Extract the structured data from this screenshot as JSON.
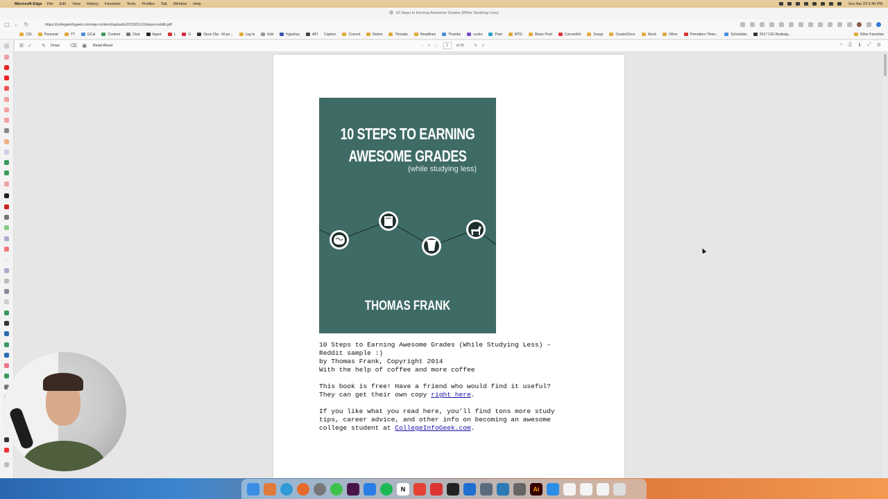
{
  "menubar": {
    "apple": "",
    "app_name": "Microsoft Edge",
    "menus": [
      "File",
      "Edit",
      "View",
      "History",
      "Favorites",
      "Tools",
      "Profiles",
      "Tab",
      "Window",
      "Help"
    ],
    "clock": "Sun Apr 23 5:46 PM"
  },
  "window": {
    "tab_title": "10 Steps to Earning Awesome Grades (While Studying Less)"
  },
  "address": {
    "back_icon": "back-arrow-icon",
    "refresh_icon": "refresh-icon",
    "url": "https://collegeinfogeek.com/wp-content/uploads/2015/01/10steps-reddit.pdf"
  },
  "favorites": {
    "items": [
      "CIG",
      "Personal",
      "YT",
      "GCal",
      "Content",
      "Chat",
      "Agent",
      "L",
      "G",
      "Opus Clip - AI-po...",
      "Log In",
      "Edit",
      "Hypefury",
      "API",
      "Caption",
      "Current",
      "Notion",
      "Threads",
      "Headlines",
      "Thumbs",
      "ccolor",
      "Poet",
      "MTG",
      "Music Prod",
      "ConvertKit",
      "Songs",
      "CreatorDocs",
      "Stock",
      "Other",
      "Pomodoro Timer...",
      "Schedules",
      "2017 CIG Redesig..."
    ],
    "other_favorites": "Other Favorites"
  },
  "pdf_toolbar": {
    "draw_label": "Draw",
    "read_aloud_label": "Read Aloud",
    "zoom_out": "−",
    "zoom_in": "+",
    "page_number": "1",
    "page_total": "of 29"
  },
  "pdf": {
    "cover": {
      "title_line1": "10 STEPS TO EARNING",
      "title_line2": "AWESOME GRADES",
      "subtitle": "(while studying less)",
      "author": "THOMAS FRANK",
      "background": "#3f6b66"
    },
    "text": {
      "line1": "10 Steps to Earning Awesome Grades (While Studying Less) –",
      "line2": "Reddit sample :)",
      "line3": "by Thomas Frank, Copyright 2014",
      "line4": "With the help of coffee and more coffee",
      "line5": "This book is free! Have a friend who would find it useful?",
      "line6_prefix": "They can get their own copy ",
      "line6_link": "right here",
      "line6_suffix": ".",
      "line7": "If you like what you read here, you’ll find tons more study",
      "line8": "tips, career advice, and other info on becoming an awesome",
      "line9_prefix": "college student at ",
      "line9_link": "CollegeInfoGeek.com",
      "line9_suffix": "."
    }
  },
  "colors": {
    "link": "#1a0dab",
    "menubar": "#e6c997"
  }
}
